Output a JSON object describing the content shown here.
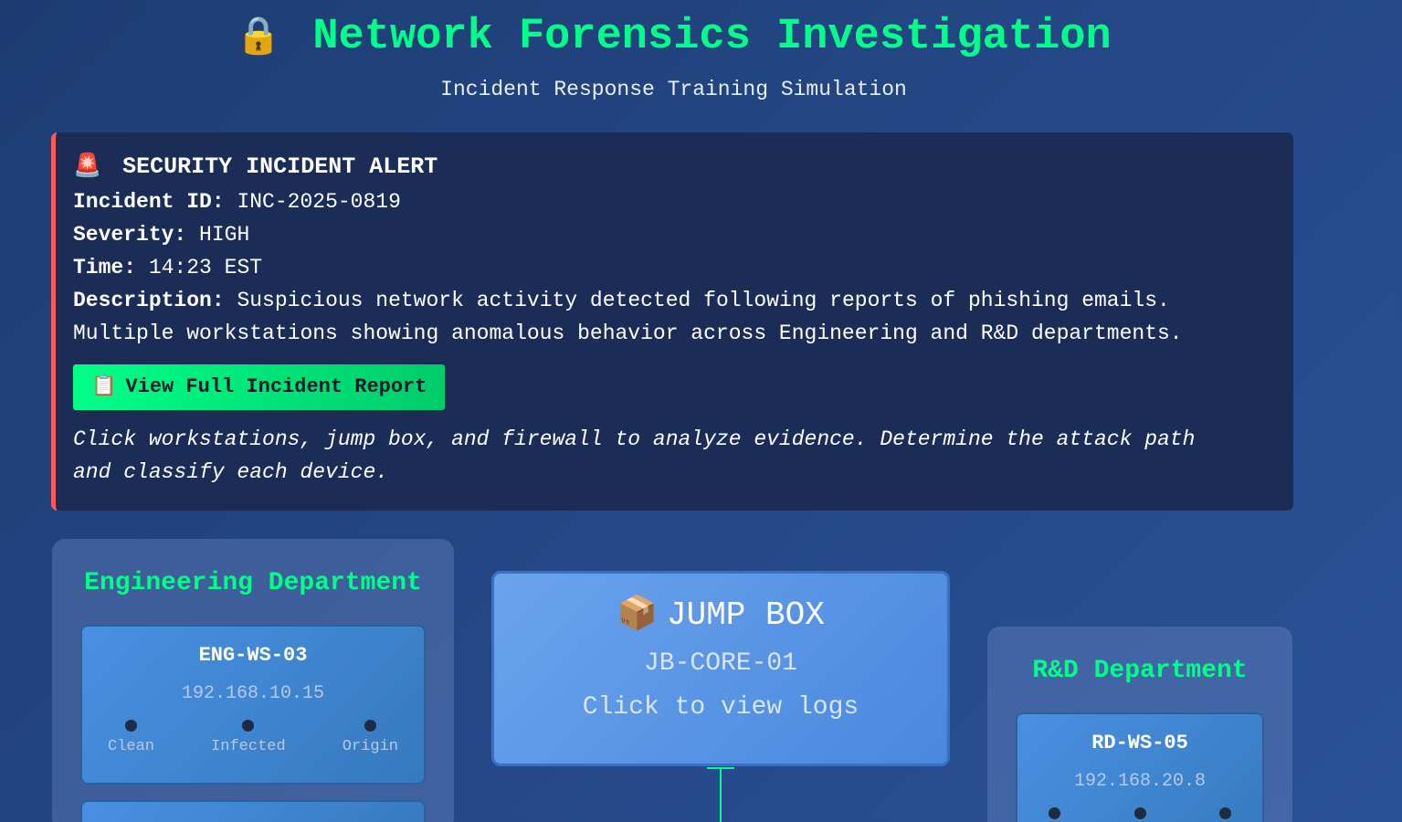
{
  "header": {
    "lock_icon": "🔒",
    "title": "Network Forensics Investigation",
    "subtitle": "Incident Response Training Simulation"
  },
  "alert": {
    "icon": "🚨",
    "title": "SECURITY INCIDENT ALERT",
    "fields": [
      {
        "label": "Incident ID:",
        "value": "INC-2025-0819"
      },
      {
        "label": "Severity:",
        "value": "HIGH"
      },
      {
        "label": "Time:",
        "value": "14:23 EST"
      }
    ],
    "description_label": "Description:",
    "description_line1": "Suspicious network activity detected following reports of phishing emails.",
    "description_line2": "Multiple workstations showing anomalous behavior across Engineering and R&D departments.",
    "report_button_icon": "📋",
    "report_button_label": "View Full Incident Report",
    "instructions_line1": "Click workstations, jump box, and firewall to analyze evidence. Determine the attack path",
    "instructions_line2": "and classify each device.",
    "border_color": "#ff5a5a"
  },
  "engineering": {
    "title": "Engineering Department",
    "workstations": [
      {
        "name": "ENG-WS-03",
        "ip": "192.168.10.15",
        "options": [
          "Clean",
          "Infected",
          "Origin"
        ]
      }
    ]
  },
  "jumpbox": {
    "icon": "📦",
    "title": "JUMP BOX",
    "id": "JB-CORE-01",
    "hint": "Click to view logs"
  },
  "rd": {
    "title": "R&D Department",
    "workstations": [
      {
        "name": "RD-WS-05",
        "ip": "192.168.20.8"
      }
    ]
  },
  "colors": {
    "accent": "#00ff88",
    "background_start": "#1e3c72",
    "background_end": "#2a5298"
  }
}
